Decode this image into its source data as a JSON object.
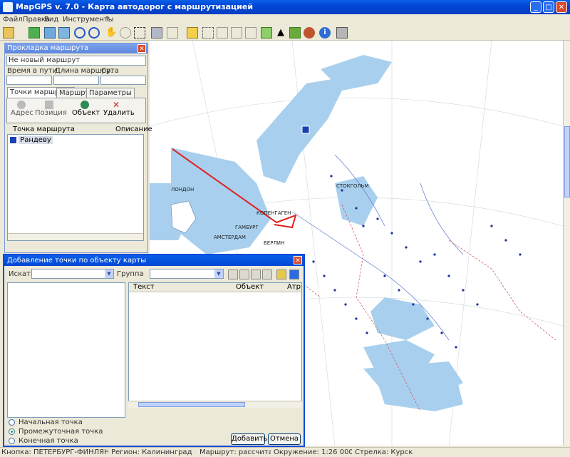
{
  "window": {
    "title": "MapGPS v. 7.0 - Карта автодорог с маршрутизацией"
  },
  "menu": [
    "Файл",
    "Правка",
    "Вид",
    "Инструменты",
    "?"
  ],
  "route_panel": {
    "title": "Прокладка маршрута",
    "route_name": "Не новый маршрут",
    "columns": [
      "Время в пути",
      "Длина маршрута",
      "Ср. скорость"
    ],
    "tabs": [
      "Точки маршрута",
      "Маршрут",
      "Параметры"
    ],
    "buttons": [
      "Адрес",
      "Позиция",
      "Объект",
      "Удалить"
    ],
    "list_header": [
      "Точка маршрута",
      "Описание"
    ],
    "points": [
      "Рандеву"
    ]
  },
  "dialog": {
    "title": "Добавление точки по объекту карты",
    "search_label": "Искать",
    "search_value": "",
    "group_label": "Группа",
    "group_value": "",
    "result_columns": [
      "Текст",
      "Объект",
      "Атрибут"
    ],
    "radio_options": [
      "Начальная точка",
      "Промежуточная точка",
      "Конечная точка"
    ],
    "selected_radio": 1,
    "add_button": "Добавить",
    "cancel_button": "Отмена"
  },
  "map_labels": [
    "СТОКГОЛЬМ",
    "КОПЕНГАГЕН",
    "ГАМБУРГ",
    "АМСТЕРДАМ",
    "БЕРЛИН",
    "ЛОНДОН"
  ],
  "status": {
    "segments": [
      "Кнопка: ПЕТЕРБУРГ-ФИНЛЯНДИЯ",
      "Регион: Калининград",
      "Маршрут: рассчитан",
      "Окружение: 1:26 000 000",
      "Стрелка: Курск"
    ]
  },
  "colors": {
    "water": "#a8d0ee",
    "route": "#e02020",
    "titlebar": "#0a4bd8"
  }
}
